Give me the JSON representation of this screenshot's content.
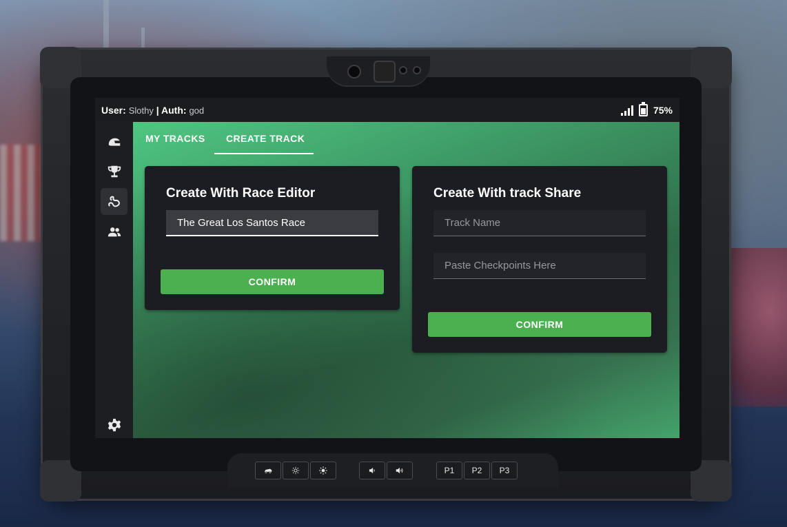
{
  "status_bar": {
    "user_label": "User:",
    "user_value": "Slothy",
    "auth_label": "| Auth:",
    "auth_value": "god",
    "battery_percent": "75%",
    "signal_bars": 4
  },
  "sidebar": {
    "items": [
      {
        "icon": "helmet-icon",
        "active": false
      },
      {
        "icon": "trophy-icon",
        "active": false
      },
      {
        "icon": "track-icon",
        "active": true
      },
      {
        "icon": "users-icon",
        "active": false
      }
    ],
    "footer_icon": "gear-icon"
  },
  "tabs": [
    {
      "label": "MY TRACKS",
      "active": false
    },
    {
      "label": "CREATE TRACK",
      "active": true
    }
  ],
  "race_editor_card": {
    "title": "Create With Race Editor",
    "track_name_value": "The Great Los Santos Race",
    "confirm_label": "CONFIRM"
  },
  "track_share_card": {
    "title": "Create With track Share",
    "track_name_placeholder": "Track Name",
    "checkpoints_placeholder": "Paste Checkpoints Here",
    "confirm_label": "CONFIRM"
  },
  "hardware_buttons": {
    "brightness": [
      "car-icon",
      "brightness-down-icon",
      "brightness-up-icon"
    ],
    "volume": [
      "volume-down-icon",
      "volume-up-icon"
    ],
    "presets": [
      "P1",
      "P2",
      "P3"
    ]
  },
  "colors": {
    "accent_green": "#4caf50",
    "card_bg": "#1c1d22",
    "content_gradient_top": "#4fc680"
  }
}
